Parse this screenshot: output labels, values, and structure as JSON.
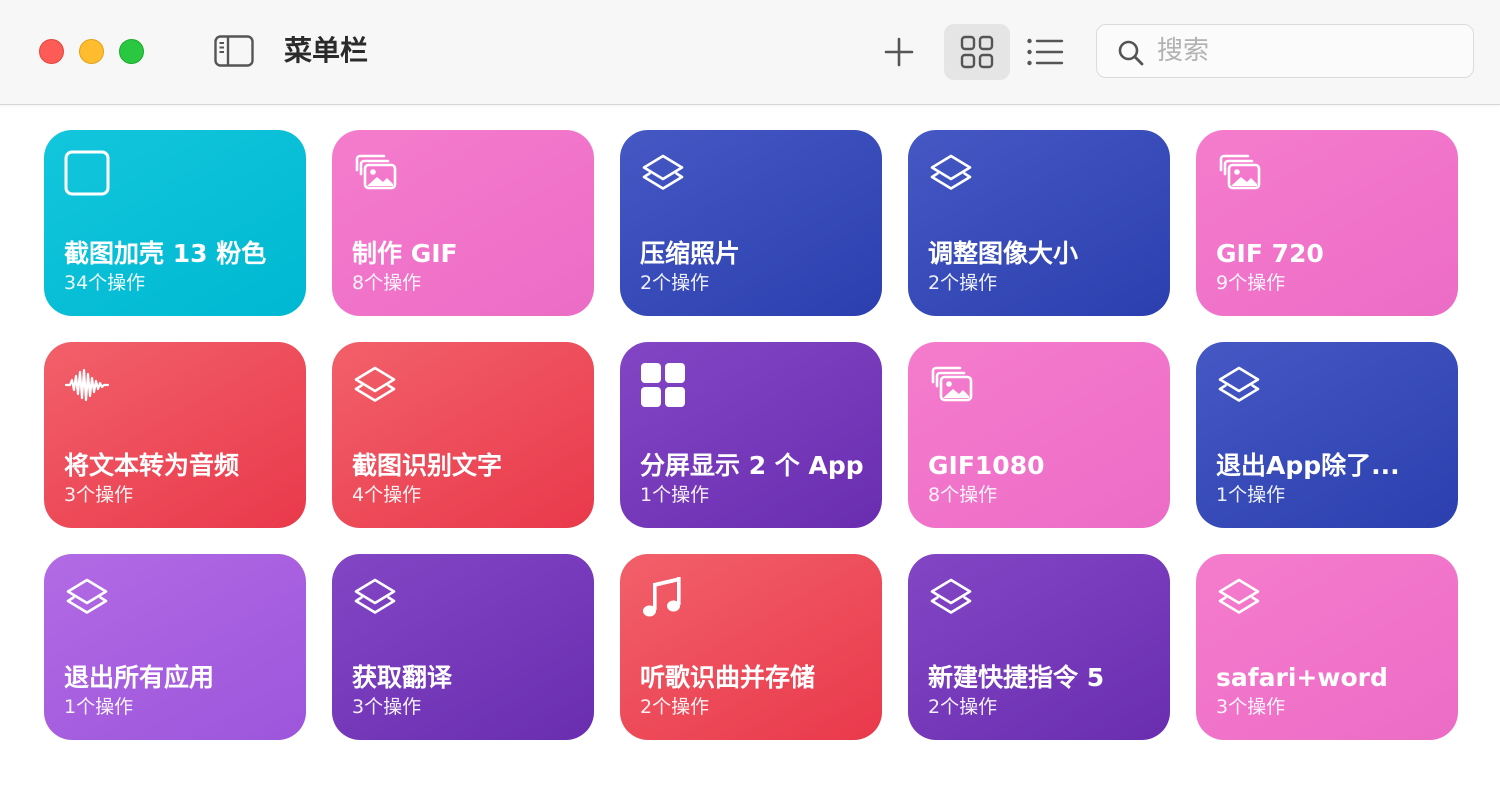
{
  "window": {
    "title": "菜单栏"
  },
  "toolbar": {
    "add_icon": "plus-icon",
    "grid_icon": "grid-view-icon",
    "list_icon": "list-view-icon",
    "sidebar_icon": "sidebar-toggle-icon",
    "active_view": "grid"
  },
  "search": {
    "placeholder": "搜索",
    "value": ""
  },
  "colors": {
    "close": "#fd5b55",
    "minimize": "#febc2e",
    "zoom": "#2ac840",
    "cyan": "#00b8d2",
    "pink": "#ef70c8",
    "blue": "#3346b6",
    "red": "#ec4453",
    "purple": "#7335b8",
    "violet": "#a35bde"
  },
  "shortcuts": [
    {
      "title": "截图加壳 13 粉色",
      "subtitle": "34个操作",
      "color": "cyan",
      "icon": "square-icon"
    },
    {
      "title": "制作 GIF",
      "subtitle": "8个操作",
      "color": "pink",
      "icon": "photos-icon"
    },
    {
      "title": "压缩照片",
      "subtitle": "2个操作",
      "color": "blue",
      "icon": "layers-icon"
    },
    {
      "title": "调整图像大小",
      "subtitle": "2个操作",
      "color": "blue",
      "icon": "layers-icon"
    },
    {
      "title": "GIF 720",
      "subtitle": "9个操作",
      "color": "pink",
      "icon": "photos-icon"
    },
    {
      "title": "将文本转为音频",
      "subtitle": "3个操作",
      "color": "red",
      "icon": "waveform-icon"
    },
    {
      "title": "截图识别文字",
      "subtitle": "4个操作",
      "color": "red",
      "icon": "layers-icon"
    },
    {
      "title": "分屏显示 2 个 App",
      "subtitle": "1个操作",
      "color": "purple",
      "icon": "grid-squares-icon"
    },
    {
      "title": "GIF1080",
      "subtitle": "8个操作",
      "color": "pink",
      "icon": "photos-icon"
    },
    {
      "title": "退出App除了...",
      "subtitle": "1个操作",
      "color": "blue",
      "icon": "layers-icon"
    },
    {
      "title": "退出所有应用",
      "subtitle": "1个操作",
      "color": "violet",
      "icon": "layers-icon"
    },
    {
      "title": "获取翻译",
      "subtitle": "3个操作",
      "color": "purple",
      "icon": "layers-icon"
    },
    {
      "title": "听歌识曲并存储",
      "subtitle": "2个操作",
      "color": "red",
      "icon": "music-note-icon"
    },
    {
      "title": "新建快捷指令 5",
      "subtitle": "2个操作",
      "color": "purple",
      "icon": "layers-icon"
    },
    {
      "title": "safari+word",
      "subtitle": "3个操作",
      "color": "pink",
      "icon": "layers-icon"
    }
  ]
}
